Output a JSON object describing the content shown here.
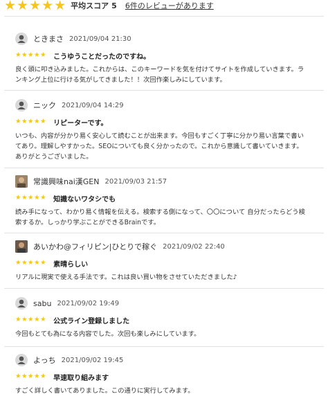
{
  "summary": {
    "stars": "★★★★★",
    "score_label": "平均スコア",
    "score_value": "5",
    "review_count_link": "6件のレビューがあります"
  },
  "reviews": [
    {
      "name": "ときまさ",
      "date": "2021/09/04 21:30",
      "stars": "★★★★★",
      "title": "こうゆうことだったのですね。",
      "body": "良く頭に叩き込みました。これからは、このキーワードを気を付けてサイトを作成していきます。ラ\nンキング上位に行ける気がしてきました！！次回作楽しみにしています。"
    },
    {
      "name": "ニック",
      "date": "2021/09/04 14:29",
      "stars": "★★★★★",
      "title": "リピーターです。",
      "body": "いつも、内容が分かり易く安心して読むことが出来ます。今回もすごく丁寧に分かり易い言葉で書い\nてあり。理解しやすかった。SEOについても良く分かったので。これから意識して書いていきます。\nありがとうございました。"
    },
    {
      "name": "常識興味nai漢GEN",
      "date": "2021/09/03 21:57",
      "stars": "★★★★★",
      "title": "知識ないワタシでも",
      "body": "読み手になって、わかり易く情報を伝える。検索する側になって、〇〇について 自分だったらどう検\n索するか。しっかり学ぶことができるBrainです。"
    },
    {
      "name": "あいかわ@フィリピン|ひとりで稼ぐ",
      "date": "2021/09/02 22:40",
      "stars": "★★★★★",
      "title": "素晴らしい",
      "body": "リアルに現実で使える手法です。これは良い買い物をさせていただきました♪"
    },
    {
      "name": "sabu",
      "date": "2021/09/02 19:49",
      "stars": "★★★★★",
      "title": "公式ライン登録しました",
      "body": "今回もとても為になる内容でした。次回も楽しみにしています。"
    },
    {
      "name": "よっち",
      "date": "2021/09/02 19:45",
      "stars": "★★★★★",
      "title": "早速取り組みます",
      "body": "すごく詳しく書いてありました。この通りに実行してみます。"
    }
  ]
}
